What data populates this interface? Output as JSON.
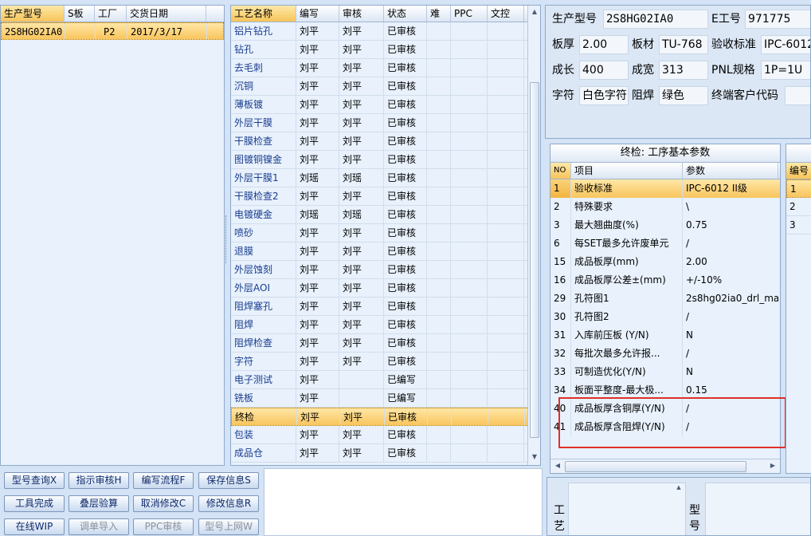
{
  "left_table": {
    "columns": [
      "生产型号",
      "S板",
      "工厂",
      "交货日期"
    ],
    "rows": [
      {
        "model": "2S8HG02IA0",
        "sboard": "",
        "factory": "P2",
        "date": "2017/3/17"
      }
    ]
  },
  "process_table": {
    "columns": [
      "工艺名称",
      "编写",
      "审核",
      "状态",
      "难",
      "PPC",
      "文控"
    ],
    "rows": [
      {
        "name": "铝片钻孔",
        "writer": "刘平",
        "auditor": "刘平",
        "status": "已审核"
      },
      {
        "name": "钻孔",
        "writer": "刘平",
        "auditor": "刘平",
        "status": "已审核"
      },
      {
        "name": "去毛刺",
        "writer": "刘平",
        "auditor": "刘平",
        "status": "已审核"
      },
      {
        "name": "沉铜",
        "writer": "刘平",
        "auditor": "刘平",
        "status": "已审核"
      },
      {
        "name": "薄板镀",
        "writer": "刘平",
        "auditor": "刘平",
        "status": "已审核"
      },
      {
        "name": "外层干膜",
        "writer": "刘平",
        "auditor": "刘平",
        "status": "已审核"
      },
      {
        "name": "干膜检查",
        "writer": "刘平",
        "auditor": "刘平",
        "status": "已审核"
      },
      {
        "name": "图镀铜镍金",
        "writer": "刘平",
        "auditor": "刘平",
        "status": "已审核"
      },
      {
        "name": "外层干膜1",
        "writer": "刘瑶",
        "auditor": "刘瑶",
        "status": "已审核"
      },
      {
        "name": "干膜检查2",
        "writer": "刘平",
        "auditor": "刘平",
        "status": "已审核"
      },
      {
        "name": "电镀硬金",
        "writer": "刘瑶",
        "auditor": "刘瑶",
        "status": "已审核"
      },
      {
        "name": "喷砂",
        "writer": "刘平",
        "auditor": "刘平",
        "status": "已审核"
      },
      {
        "name": "退膜",
        "writer": "刘平",
        "auditor": "刘平",
        "status": "已审核"
      },
      {
        "name": "外层蚀刻",
        "writer": "刘平",
        "auditor": "刘平",
        "status": "已审核"
      },
      {
        "name": "外层AOI",
        "writer": "刘平",
        "auditor": "刘平",
        "status": "已审核"
      },
      {
        "name": "阻焊塞孔",
        "writer": "刘平",
        "auditor": "刘平",
        "status": "已审核"
      },
      {
        "name": "阻焊",
        "writer": "刘平",
        "auditor": "刘平",
        "status": "已审核"
      },
      {
        "name": "阻焊检查",
        "writer": "刘平",
        "auditor": "刘平",
        "status": "已审核"
      },
      {
        "name": "字符",
        "writer": "刘平",
        "auditor": "刘平",
        "status": "已审核"
      },
      {
        "name": "电子测试",
        "writer": "刘平",
        "auditor": "",
        "status": "已编写"
      },
      {
        "name": "铣板",
        "writer": "刘平",
        "auditor": "",
        "status": "已编写"
      },
      {
        "name": "终检",
        "writer": "刘平",
        "auditor": "刘平",
        "status": "已审核"
      },
      {
        "name": "包装",
        "writer": "刘平",
        "auditor": "刘平",
        "status": "已审核"
      },
      {
        "name": "成品仓",
        "writer": "刘平",
        "auditor": "刘平",
        "status": "已审核"
      }
    ]
  },
  "buttons": {
    "row1": [
      "型号查询X",
      "指示审核H",
      "编写流程F",
      "保存信息S"
    ],
    "row2": [
      "工具完成",
      "叠层验算",
      "取消修改C",
      "修改信息R"
    ],
    "row3": [
      "在线WIP",
      "调单导入",
      "PPC审核",
      "型号上网W"
    ]
  },
  "info": {
    "model_label": "生产型号",
    "model_value": "2S8HG02IA0",
    "eno_label": "E工号",
    "eno_value": "971775",
    "thick_label": "板厚",
    "thick_value": "2.00",
    "material_label": "板材",
    "material_value": "TU-768",
    "std_label": "验收标准",
    "std_value": "IPC-6012",
    "len_label": "成长",
    "len_value": "400",
    "wid_label": "成宽",
    "wid_value": "313",
    "pnl_label": "PNL规格",
    "pnl_value": "1P=1U",
    "char_label": "字符",
    "char_value": "白色字符",
    "mask_label": "阻焊",
    "mask_value": "绿色",
    "cust_label": "终端客户代码",
    "cust_value": ""
  },
  "params": {
    "title": "终检: 工序基本参数",
    "columns": [
      "NO",
      "项目",
      "参数"
    ],
    "rows": [
      {
        "no": "1",
        "item": "验收标准",
        "value": "IPC-6012 II级"
      },
      {
        "no": "2",
        "item": "特殊要求",
        "value": "\\"
      },
      {
        "no": "3",
        "item": "最大翘曲度(%)",
        "value": "0.75"
      },
      {
        "no": "6",
        "item": "每SET最多允许废单元",
        "value": "/"
      },
      {
        "no": "15",
        "item": "成品板厚(mm)",
        "value": "2.00"
      },
      {
        "no": "16",
        "item": "成品板厚公差±(mm)",
        "value": "+/-10%"
      },
      {
        "no": "29",
        "item": "孔符图1",
        "value": "2s8hg02ia0_drl_ma"
      },
      {
        "no": "30",
        "item": "孔符图2",
        "value": "/"
      },
      {
        "no": "31",
        "item": "入库前压板 (Y/N)",
        "value": "N"
      },
      {
        "no": "32",
        "item": "每批次最多允许报...",
        "value": "/"
      },
      {
        "no": "33",
        "item": "可制造优化(Y/N)",
        "value": "N"
      },
      {
        "no": "34",
        "item": "板面平整度-最大极...",
        "value": "0.15"
      },
      {
        "no": "40",
        "item": "成品板厚含铜厚(Y/N)",
        "value": "/"
      },
      {
        "no": "41",
        "item": "成品板厚含阻焊(Y/N)",
        "value": "/"
      }
    ]
  },
  "right_partial": {
    "header": "编号",
    "rows": [
      "1",
      "2",
      "3"
    ]
  },
  "bottom_right": {
    "label_a1": "工",
    "label_a2": "艺",
    "label_b1": "型",
    "label_b2": "号"
  },
  "colors": {
    "selection": "#f9c55d",
    "highlight_box": "#e0302a",
    "link_text": "#1a3d8f"
  }
}
